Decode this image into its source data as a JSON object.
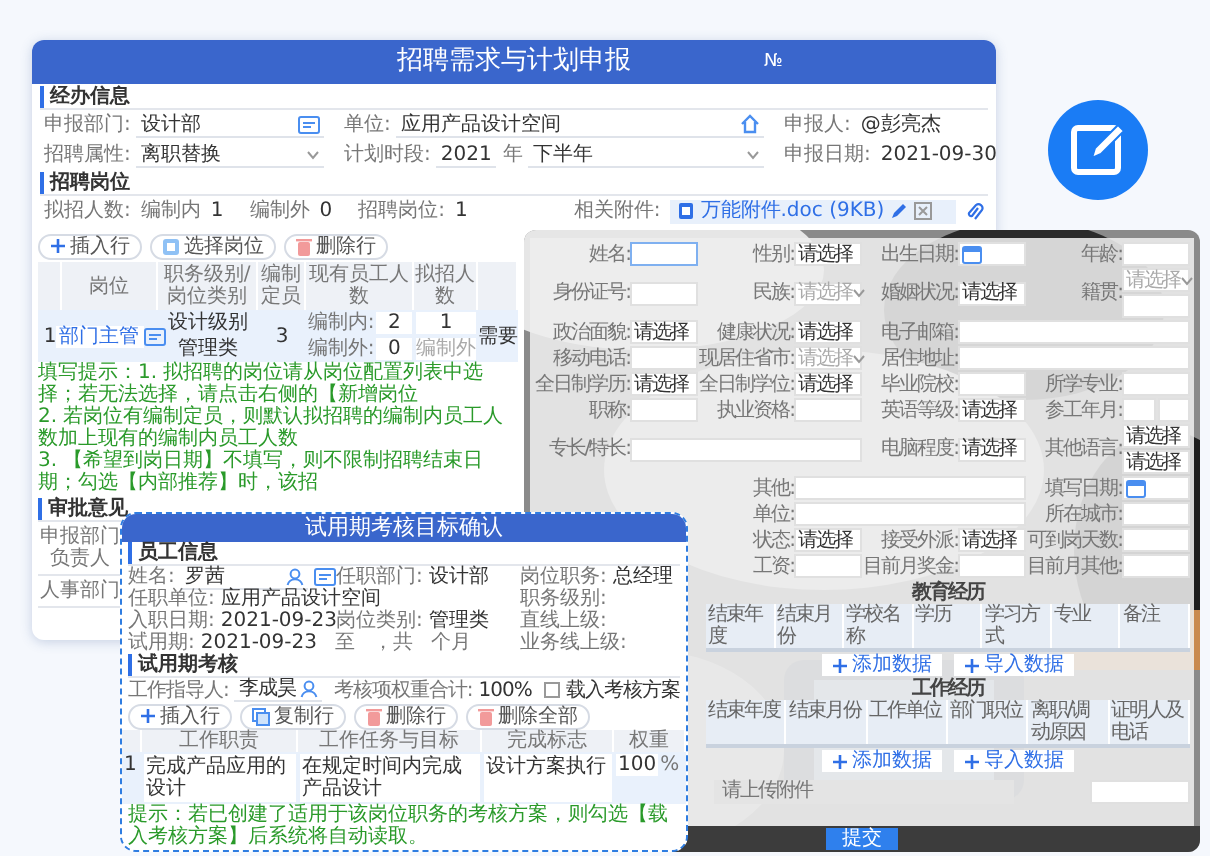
{
  "main_form": {
    "title": "招聘需求与计划申报",
    "number_mark": "№",
    "handler_section": {
      "title": "经办信息",
      "rows": [
        [
          {
            "label": "申报部门:",
            "value": "设计部",
            "kind": "picker"
          },
          {
            "label": "单位:",
            "value": "应用产品设计空间",
            "kind": "home"
          },
          {
            "label": "申报人:",
            "value": "@彭亮杰",
            "kind": "plain"
          }
        ],
        [
          {
            "label": "招聘属性:",
            "value": "离职替换",
            "kind": "select"
          },
          {
            "label": "计划时段:",
            "value": "2021",
            "kind": "period",
            "unit": "年",
            "period": "下半年"
          },
          {
            "label": "申报日期:",
            "value": "2021-09-30",
            "kind": "plain"
          }
        ]
      ]
    },
    "positions_section": {
      "title": "招聘岗位",
      "summary": [
        {
          "label": "拟招人数:"
        },
        {
          "label": "编制内",
          "value": "1"
        },
        {
          "label": "编制外",
          "value": "0"
        },
        {
          "label": "招聘岗位:",
          "value": "1"
        }
      ],
      "attachment": {
        "label": "相关附件:",
        "file": "万能附件.doc (9KB)"
      },
      "buttons": [
        {
          "label": "插入行",
          "kind": "add"
        },
        {
          "label": "选择岗位",
          "kind": "pick"
        },
        {
          "label": "删除行",
          "kind": "delete"
        }
      ],
      "table": {
        "columns": [
          "岗位",
          "职务级别/岗位类别",
          "编制定员",
          "现有员工人数",
          "拟招人数"
        ],
        "rows": [
          {
            "index": "1",
            "position": "部门主管",
            "level": "设计级别",
            "category": "管理类",
            "quota": "3",
            "current": [
              {
                "label": "编制内:",
                "value": "2"
              },
              {
                "label": "编制外:",
                "value": "0"
              }
            ],
            "planned": [
              {
                "value": "1"
              },
              {
                "placeholder": "编制外"
              }
            ],
            "column_6": "需要"
          }
        ]
      },
      "hints": [
        "填写提示：1. 拟招聘的岗位请从岗位配置列表中选择；若无法选择，请点击右侧的【新增岗位",
        "2. 若岗位有编制定员，则默认拟招聘的编制内员工人数加上现有的编制内员工人数",
        "3. 【希望到岗日期】不填写，则不限制招聘结束日期；勾选【内部推荐】时，该招"
      ]
    },
    "approval": {
      "title": "审批意见",
      "rows": [
        "申报部门负责人",
        "人事部门"
      ]
    }
  },
  "applicant_form": {
    "rows": [
      {
        "kind": "full",
        "cells": [
          {
            "label": "姓名:",
            "fields": [
              {
                "kind": "active"
              }
            ]
          },
          {
            "label": "性别:",
            "fields": [
              {
                "kind": "choice",
                "value": "请选择"
              }
            ]
          },
          {
            "label": "出生日期:",
            "fields": [
              {
                "kind": "date"
              }
            ]
          },
          {
            "label": "年龄:",
            "fields": [
              {
                "kind": "text"
              }
            ]
          }
        ]
      },
      {
        "kind": "full",
        "cells": [
          {
            "label": "身份证号:",
            "fields": [
              {
                "kind": "text"
              }
            ]
          },
          {
            "label": "民族:",
            "fields": [
              {
                "kind": "select",
                "placeholder": "请选择"
              }
            ]
          },
          {
            "label": "婚姻状况:",
            "fields": [
              {
                "kind": "choice",
                "value": "请选择"
              }
            ]
          },
          {
            "label": "籍贯:",
            "fields": [
              {
                "kind": "select",
                "placeholder": "请选择"
              },
              {
                "kind": "text"
              }
            ]
          }
        ]
      },
      {
        "kind": "full",
        "cells": [
          {
            "label": "政治面貌:",
            "fields": [
              {
                "kind": "choice",
                "value": "请选择"
              }
            ]
          },
          {
            "label": "健康状况:",
            "fields": [
              {
                "kind": "choice",
                "value": "请选择"
              }
            ]
          },
          {
            "label": "电子邮箱:",
            "wide": true,
            "fields": [
              {
                "kind": "text"
              }
            ]
          }
        ]
      },
      {
        "kind": "full",
        "cells": [
          {
            "label": "移动电话:",
            "fields": [
              {
                "kind": "text"
              }
            ]
          },
          {
            "label": "现居住省市:",
            "fields": [
              {
                "kind": "select",
                "placeholder": "请选择"
              }
            ]
          },
          {
            "label": "居住地址:",
            "wide": true,
            "fields": [
              {
                "kind": "text"
              }
            ]
          }
        ]
      },
      {
        "kind": "full",
        "cells": [
          {
            "label": "全日制学历:",
            "fields": [
              {
                "kind": "choice",
                "value": "请选择"
              }
            ]
          },
          {
            "label": "全日制学位:",
            "fields": [
              {
                "kind": "choice",
                "value": "请选择"
              }
            ]
          },
          {
            "label": "毕业院校:",
            "fields": [
              {
                "kind": "text"
              }
            ]
          },
          {
            "label": "所学专业:",
            "fields": [
              {
                "kind": "text"
              }
            ]
          }
        ]
      },
      {
        "kind": "full",
        "cells": [
          {
            "label": "职称:",
            "fields": [
              {
                "kind": "text"
              }
            ]
          },
          {
            "label": "执业资格:",
            "fields": [
              {
                "kind": "text"
              }
            ]
          },
          {
            "label": "英语等级:",
            "fields": [
              {
                "kind": "choice",
                "value": "请选择"
              }
            ]
          },
          {
            "label": "参工年月:",
            "fields": [
              {
                "kind": "text"
              },
              {
                "kind": "text"
              }
            ]
          }
        ]
      },
      {
        "kind": "full",
        "cells": [
          {
            "label": "专长/特长:",
            "wide": true,
            "fields": [
              {
                "kind": "text"
              }
            ]
          },
          {
            "label": "电脑程度:",
            "fields": [
              {
                "kind": "choice",
                "value": "请选择"
              }
            ]
          },
          {
            "label": "其他语言:",
            "fields": [
              {
                "kind": "choice",
                "value": "请选择"
              },
              {
                "kind": "choice",
                "value": "请选择"
              }
            ]
          }
        ]
      },
      {
        "kind": "partial",
        "cells": [
          {
            "label": "其他:",
            "wide": true,
            "fields": [
              {
                "kind": "text"
              }
            ]
          },
          {
            "label": "填写日期:",
            "fields": [
              {
                "kind": "date"
              }
            ]
          }
        ]
      },
      {
        "kind": "partial",
        "cells": [
          {
            "label": "单位:",
            "wide": true,
            "fields": [
              {
                "kind": "text"
              }
            ]
          },
          {
            "label": "所在城市:",
            "fields": [
              {
                "kind": "text"
              }
            ]
          }
        ]
      },
      {
        "kind": "partial",
        "cells": [
          {
            "label": "状态:",
            "fields": [
              {
                "kind": "choice",
                "value": "请选择"
              }
            ]
          },
          {
            "label": "接受外派:",
            "fields": [
              {
                "kind": "choice",
                "value": "请选择"
              }
            ]
          },
          {
            "label": "可到岗天数:",
            "fields": [
              {
                "kind": "text"
              }
            ]
          }
        ]
      },
      {
        "kind": "partial",
        "cells": [
          {
            "label": "工资:",
            "fields": [
              {
                "kind": "text"
              }
            ]
          },
          {
            "label": "目前月奖金:",
            "fields": [
              {
                "kind": "text"
              }
            ]
          },
          {
            "label": "目前月其他:",
            "fields": [
              {
                "kind": "text"
              }
            ]
          }
        ]
      }
    ],
    "education": {
      "title": "教育经历",
      "columns": [
        "结束年度",
        "结束月份",
        "学校名称",
        "学历",
        "学习方式",
        "专业",
        "备注"
      ],
      "buttons": [
        "添加数据",
        "导入数据"
      ]
    },
    "work": {
      "title": "工作经历",
      "columns": [
        "结束年度",
        "结束月份",
        "工作单位",
        "部门职位",
        "离职/调动原因",
        "证明人及电话"
      ],
      "buttons": [
        "添加数据",
        "导入数据"
      ]
    },
    "upload": {
      "placeholder": "请上传附件"
    },
    "submit": "提交"
  },
  "probation_form": {
    "title": "试用期考核目标确认",
    "employee_section": {
      "title": "员工信息",
      "rows": [
        [
          {
            "label": "姓名:",
            "value": "罗茜",
            "kind": "person"
          },
          {
            "label": "任职部门:",
            "value": "设计部",
            "kind": "plain"
          },
          {
            "label": "岗位职务:",
            "value": "总经理",
            "kind": "plain"
          }
        ],
        [
          {
            "label": "任职单位:",
            "value": "应用产品设计空间",
            "kind": "wide"
          },
          {
            "label": "职务级别:",
            "kind": "plain"
          }
        ],
        [
          {
            "label": "入职日期:",
            "value": "2021-09-23",
            "kind": "plain"
          },
          {
            "label": "岗位类别:",
            "value": "管理类",
            "kind": "plain"
          },
          {
            "label": "直线上级:",
            "kind": "plain"
          }
        ],
        [
          {
            "label": "试用期:",
            "value": "2021-09-23",
            "kind": "range",
            "parts": [
              "至",
              "，共",
              "个月"
            ]
          },
          {
            "label": "业务线上级:",
            "kind": "plain"
          }
        ]
      ]
    },
    "probation_section": {
      "title": "试用期考核",
      "mentor": {
        "label": "工作指导人:",
        "value": "李成昊"
      },
      "weight": {
        "label": "考核项权重合计:",
        "value": "100%"
      },
      "load_plan": {
        "label": "载入考核方案",
        "checked": false
      },
      "buttons": [
        {
          "label": "插入行",
          "kind": "add"
        },
        {
          "label": "复制行",
          "kind": "copy"
        },
        {
          "label": "删除行",
          "kind": "delete"
        },
        {
          "label": "删除全部",
          "kind": "delete"
        }
      ],
      "table": {
        "columns": [
          "工作职责",
          "工作任务与目标",
          "完成标志",
          "权重"
        ],
        "rows": [
          {
            "index": "1",
            "cells": [
              "完成产品应用的设计",
              "在规定时间内完成产品设计",
              "设计方案执行"
            ],
            "weight": "100",
            "unit": "%"
          }
        ]
      },
      "hint": "提示：若已创建了适用于该岗位职务的考核方案，则勾选【载入考核方案】后系统将自动读取。"
    }
  }
}
